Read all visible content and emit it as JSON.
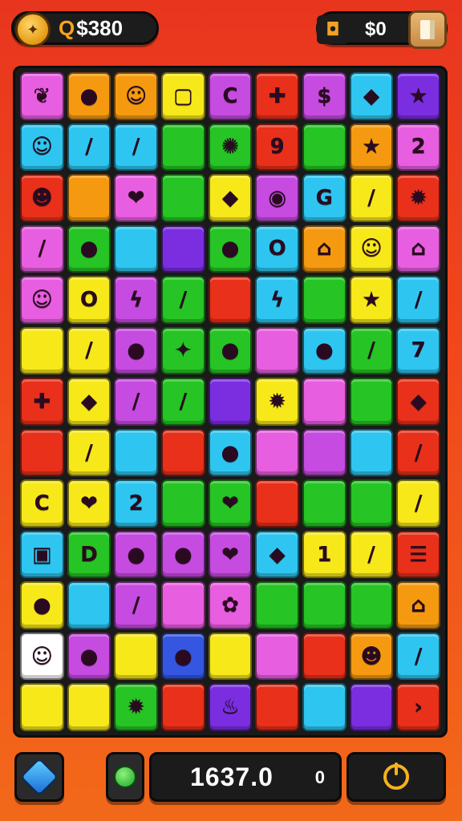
{
  "hud": {
    "coins": "$380",
    "coin_prefix": "Q",
    "cash": "$0",
    "score": "1637.0",
    "score_extra": "0"
  },
  "colors": {
    "background": "#e8361e",
    "board": "#1a1a1a",
    "accent": "#f4b21c"
  },
  "grid": {
    "columns": 9,
    "rows": 13,
    "tiles": [
      [
        {
          "c": "#e85ee0",
          "g": "❦"
        },
        {
          "c": "#f59a10",
          "g": "●"
        },
        {
          "c": "#f59a10",
          "g": "☺"
        },
        {
          "c": "#f7e81a",
          "g": "▢"
        },
        {
          "c": "#c64be0",
          "g": "C"
        },
        {
          "c": "#e8301a",
          "g": "✚"
        },
        {
          "c": "#c64be0",
          "g": "$"
        },
        {
          "c": "#2ec6f0",
          "g": "◆"
        },
        {
          "c": "#7a2ee0",
          "g": "★"
        }
      ],
      [
        {
          "c": "#2ec6f0",
          "g": "☺"
        },
        {
          "c": "#2ec6f0",
          "g": "/"
        },
        {
          "c": "#2ec6f0",
          "g": "/"
        },
        {
          "c": "#26c424",
          "g": ""
        },
        {
          "c": "#26c424",
          "g": "✺"
        },
        {
          "c": "#e8301a",
          "g": "9"
        },
        {
          "c": "#26c424",
          "g": ""
        },
        {
          "c": "#f59a10",
          "g": "★"
        },
        {
          "c": "#e85ee0",
          "g": "2"
        }
      ],
      [
        {
          "c": "#e8301a",
          "g": "☻"
        },
        {
          "c": "#f59a10",
          "g": ""
        },
        {
          "c": "#e85ee0",
          "g": "❤"
        },
        {
          "c": "#26c424",
          "g": ""
        },
        {
          "c": "#f7e81a",
          "g": "◆"
        },
        {
          "c": "#c64be0",
          "g": "◉"
        },
        {
          "c": "#2ec6f0",
          "g": "G"
        },
        {
          "c": "#f7e81a",
          "g": "/"
        },
        {
          "c": "#e8301a",
          "g": "✹"
        }
      ],
      [
        {
          "c": "#e85ee0",
          "g": "/"
        },
        {
          "c": "#26c424",
          "g": "●"
        },
        {
          "c": "#2ec6f0",
          "g": ""
        },
        {
          "c": "#7a2ee0",
          "g": ""
        },
        {
          "c": "#26c424",
          "g": "●"
        },
        {
          "c": "#2ec6f0",
          "g": "O"
        },
        {
          "c": "#f59a10",
          "g": "⌂"
        },
        {
          "c": "#f7e81a",
          "g": "☺"
        },
        {
          "c": "#e85ee0",
          "g": "⌂"
        }
      ],
      [
        {
          "c": "#e85ee0",
          "g": "☺"
        },
        {
          "c": "#f7e81a",
          "g": "O"
        },
        {
          "c": "#c64be0",
          "g": "ϟ"
        },
        {
          "c": "#26c424",
          "g": "/"
        },
        {
          "c": "#e8301a",
          "g": ""
        },
        {
          "c": "#2ec6f0",
          "g": "ϟ"
        },
        {
          "c": "#26c424",
          "g": ""
        },
        {
          "c": "#f7e81a",
          "g": "★"
        },
        {
          "c": "#2ec6f0",
          "g": "/"
        }
      ],
      [
        {
          "c": "#f7e81a",
          "g": ""
        },
        {
          "c": "#f7e81a",
          "g": "/"
        },
        {
          "c": "#c64be0",
          "g": "●"
        },
        {
          "c": "#26c424",
          "g": "✦"
        },
        {
          "c": "#26c424",
          "g": "●"
        },
        {
          "c": "#e85ee0",
          "g": ""
        },
        {
          "c": "#2ec6f0",
          "g": "●"
        },
        {
          "c": "#26c424",
          "g": "/"
        },
        {
          "c": "#2ec6f0",
          "g": "7"
        }
      ],
      [
        {
          "c": "#e8301a",
          "g": "✚"
        },
        {
          "c": "#f7e81a",
          "g": "◆"
        },
        {
          "c": "#c64be0",
          "g": "/"
        },
        {
          "c": "#26c424",
          "g": "/"
        },
        {
          "c": "#7a2ee0",
          "g": ""
        },
        {
          "c": "#f7e81a",
          "g": "✹"
        },
        {
          "c": "#e85ee0",
          "g": ""
        },
        {
          "c": "#26c424",
          "g": ""
        },
        {
          "c": "#e8301a",
          "g": "◆"
        }
      ],
      [
        {
          "c": "#e8301a",
          "g": ""
        },
        {
          "c": "#f7e81a",
          "g": "/"
        },
        {
          "c": "#2ec6f0",
          "g": ""
        },
        {
          "c": "#e8301a",
          "g": ""
        },
        {
          "c": "#2ec6f0",
          "g": "●"
        },
        {
          "c": "#e85ee0",
          "g": ""
        },
        {
          "c": "#c64be0",
          "g": ""
        },
        {
          "c": "#2ec6f0",
          "g": ""
        },
        {
          "c": "#e8301a",
          "g": "/"
        }
      ],
      [
        {
          "c": "#f7e81a",
          "g": "C"
        },
        {
          "c": "#f7e81a",
          "g": "❤"
        },
        {
          "c": "#2ec6f0",
          "g": "2"
        },
        {
          "c": "#26c424",
          "g": ""
        },
        {
          "c": "#26c424",
          "g": "❤"
        },
        {
          "c": "#e8301a",
          "g": ""
        },
        {
          "c": "#26c424",
          "g": ""
        },
        {
          "c": "#26c424",
          "g": ""
        },
        {
          "c": "#f7e81a",
          "g": "/"
        }
      ],
      [
        {
          "c": "#2ec6f0",
          "g": "▣"
        },
        {
          "c": "#26c424",
          "g": "D"
        },
        {
          "c": "#c64be0",
          "g": "●"
        },
        {
          "c": "#c64be0",
          "g": "●"
        },
        {
          "c": "#c64be0",
          "g": "❤"
        },
        {
          "c": "#2ec6f0",
          "g": "◆"
        },
        {
          "c": "#f7e81a",
          "g": "1"
        },
        {
          "c": "#f7e81a",
          "g": "/"
        },
        {
          "c": "#e8301a",
          "g": "☰"
        }
      ],
      [
        {
          "c": "#f7e81a",
          "g": "●"
        },
        {
          "c": "#2ec6f0",
          "g": ""
        },
        {
          "c": "#c64be0",
          "g": "/"
        },
        {
          "c": "#e85ee0",
          "g": ""
        },
        {
          "c": "#e85ee0",
          "g": "✿"
        },
        {
          "c": "#26c424",
          "g": ""
        },
        {
          "c": "#26c424",
          "g": ""
        },
        {
          "c": "#26c424",
          "g": ""
        },
        {
          "c": "#f59a10",
          "g": "⌂"
        }
      ],
      [
        {
          "c": "#ffffff",
          "g": "☺"
        },
        {
          "c": "#c64be0",
          "g": "●"
        },
        {
          "c": "#f7e81a",
          "g": ""
        },
        {
          "c": "#3456e0",
          "g": "●"
        },
        {
          "c": "#f7e81a",
          "g": ""
        },
        {
          "c": "#e85ee0",
          "g": ""
        },
        {
          "c": "#e8301a",
          "g": ""
        },
        {
          "c": "#f59a10",
          "g": "☻"
        },
        {
          "c": "#2ec6f0",
          "g": "/"
        }
      ],
      [
        {
          "c": "#f7e81a",
          "g": ""
        },
        {
          "c": "#f7e81a",
          "g": ""
        },
        {
          "c": "#26c424",
          "g": "✹"
        },
        {
          "c": "#e8301a",
          "g": ""
        },
        {
          "c": "#7a2ee0",
          "g": "♨"
        },
        {
          "c": "#e8301a",
          "g": ""
        },
        {
          "c": "#2ec6f0",
          "g": ""
        },
        {
          "c": "#7a2ee0",
          "g": ""
        },
        {
          "c": "#e8301a",
          "g": "›"
        }
      ]
    ]
  }
}
